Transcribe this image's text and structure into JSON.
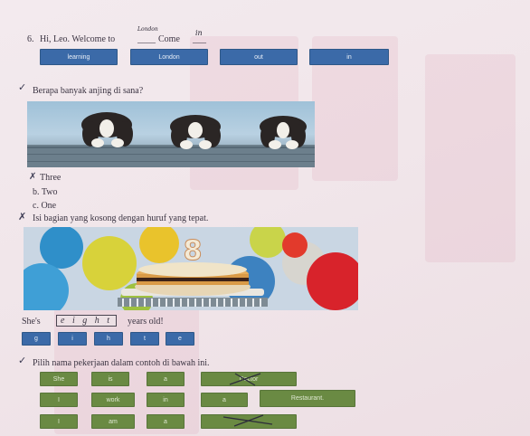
{
  "q_greeting": {
    "number": "6.",
    "text_before": "Hi, Leo. Welcome to",
    "text_after": "Come",
    "handwritten_1": "London",
    "handwritten_2": "in",
    "options": [
      "learning",
      "London",
      "out",
      "in"
    ]
  },
  "q_dogs": {
    "prompt": "Berapa banyak anjing di sana?",
    "answers": [
      "Three",
      "b. Two",
      "c. One"
    ]
  },
  "q_birthday": {
    "prompt": "Isi bagian yang kosong dengan huruf yang tepat.",
    "sentence_before": "She's",
    "sentence_filled": "e i g h t",
    "sentence_after": "years old!",
    "cake_number": "8",
    "letters": [
      "g",
      "i",
      "h",
      "t",
      "e"
    ]
  },
  "q_jobs": {
    "prompt": "Pilih nama pekerjaan dalam contoh di bawah ini.",
    "row1": [
      "She",
      "is",
      "a",
      "Doctor"
    ],
    "row2": [
      "I",
      "work",
      "in",
      "a",
      "Restaurant."
    ],
    "row3": [
      "I",
      "am",
      "a",
      ""
    ]
  },
  "colors": {
    "blue_button": "#3b6aa8",
    "green_button": "#6a8a43"
  }
}
